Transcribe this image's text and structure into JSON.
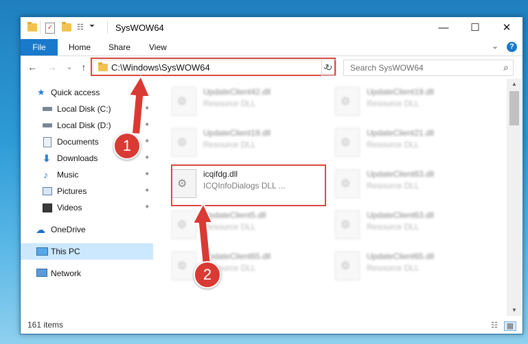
{
  "window": {
    "title": "SysWOW64",
    "minimize_glyph": "—",
    "maximize_glyph": "☐",
    "close_glyph": "✕"
  },
  "ribbon": {
    "tabs": [
      "File",
      "Home",
      "Share",
      "View"
    ],
    "help_glyph": "?",
    "expand_glyph": "⌄"
  },
  "navigation": {
    "back_glyph": "←",
    "forward_glyph": "→",
    "recent_glyph": "⌄",
    "up_glyph": "↑",
    "address": "C:\\Windows\\SysWOW64",
    "address_dropdown_glyph": "⌄",
    "refresh_glyph": "↻",
    "search_placeholder": "Search SysWOW64",
    "search_glyph": "⌕"
  },
  "sidebar": {
    "items": [
      {
        "label": "Quick access",
        "icon": "star-icon",
        "pinned": false
      },
      {
        "label": "Local Disk (C:)",
        "icon": "drive-icon",
        "pinned": true
      },
      {
        "label": "Local Disk (D:)",
        "icon": "drive-icon",
        "pinned": true
      },
      {
        "label": "Documents",
        "icon": "document-icon",
        "pinned": true
      },
      {
        "label": "Downloads",
        "icon": "download-icon",
        "pinned": true
      },
      {
        "label": "Music",
        "icon": "music-icon",
        "pinned": true
      },
      {
        "label": "Pictures",
        "icon": "picture-icon",
        "pinned": true
      },
      {
        "label": "Videos",
        "icon": "video-icon",
        "pinned": true
      },
      {
        "label": "OneDrive",
        "icon": "cloud-icon",
        "pinned": false
      },
      {
        "label": "This PC",
        "icon": "computer-icon",
        "pinned": false,
        "selected": true
      },
      {
        "label": "Network",
        "icon": "network-icon",
        "pinned": false
      }
    ],
    "pin_glyph": "📌"
  },
  "files": [
    {
      "name": "UpdateClient42.dll",
      "type": "Resource DLL"
    },
    {
      "name": "UpdateClient19.dll",
      "type": "Resource DLL"
    },
    {
      "name": "UpdateClient19.dll",
      "type": "Resource DLL"
    },
    {
      "name": "UpdateClient21.dll",
      "type": "Resource DLL"
    },
    {
      "name": "icqifdg.dll",
      "type": "ICQInfoDialogs DLL ..."
    },
    {
      "name": "UpdateClient63.dll",
      "type": "Resource DLL"
    },
    {
      "name": "UpdateClient5.dll",
      "type": "Resource DLL"
    },
    {
      "name": "UpdateClient63.dll",
      "type": "Resource DLL"
    },
    {
      "name": "UpdateClient65.dll",
      "type": "Resource DLL"
    },
    {
      "name": "UpdateClient65.dll",
      "type": "Resource DLL"
    }
  ],
  "status": {
    "item_count": "161 items"
  },
  "callouts": [
    "1",
    "2"
  ],
  "colors": {
    "accent": "#1979ca",
    "highlight": "#d9473f",
    "selection": "#cce8ff"
  }
}
